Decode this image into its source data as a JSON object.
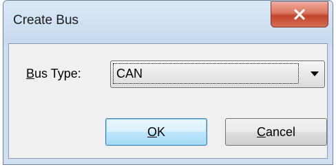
{
  "window": {
    "title": "Create Bus"
  },
  "form": {
    "bus_type_label_mnemonic": "B",
    "bus_type_label_rest": "us Type:",
    "bus_type_value": "CAN"
  },
  "buttons": {
    "ok_mnemonic": "O",
    "ok_rest": "K",
    "cancel_mnemonic": "C",
    "cancel_rest": "ancel"
  },
  "icons": {
    "close": "close-icon",
    "dropdown": "chevron-down-icon"
  },
  "colors": {
    "title_bar": "#cfdff1",
    "close_button": "#c2432c",
    "client_area": "#f0f0f0",
    "default_button_border": "#3c7fb1"
  }
}
